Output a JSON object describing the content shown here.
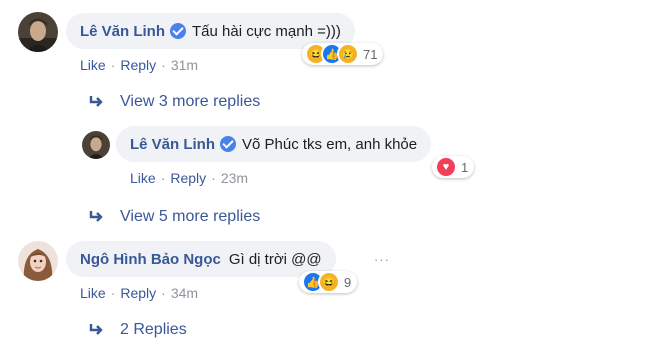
{
  "comments": [
    {
      "author": "Lê Văn Linh",
      "text": "Tấu hài cực mạnh =)))",
      "actions": {
        "like": "Like",
        "reply": "Reply",
        "time": "31m"
      },
      "reactions": {
        "icons": [
          "haha",
          "like",
          "sad"
        ],
        "count": "71"
      }
    },
    {
      "author": "Lê Văn Linh",
      "text": "Võ Phúc tks em, anh khỏe",
      "actions": {
        "like": "Like",
        "reply": "Reply",
        "time": "23m"
      },
      "reactions": {
        "icons": [
          "love"
        ],
        "count": "1"
      }
    },
    {
      "author": "Ngô Hình Bảo Ngọc",
      "text": "Gì dị trời @@",
      "actions": {
        "like": "Like",
        "reply": "Reply",
        "time": "34m"
      },
      "reactions": {
        "icons": [
          "like",
          "haha"
        ],
        "count": "9"
      }
    }
  ],
  "reply_links": {
    "view_3": "View 3 more replies",
    "view_5": "View 5 more replies",
    "two_replies": "2 Replies"
  },
  "separator": "·",
  "more_options": "···",
  "colors": {
    "link": "#385898",
    "bubble": "#f0f2f5",
    "like": "#1877f2",
    "love": "#f33e58",
    "haha": "#f7b125"
  }
}
